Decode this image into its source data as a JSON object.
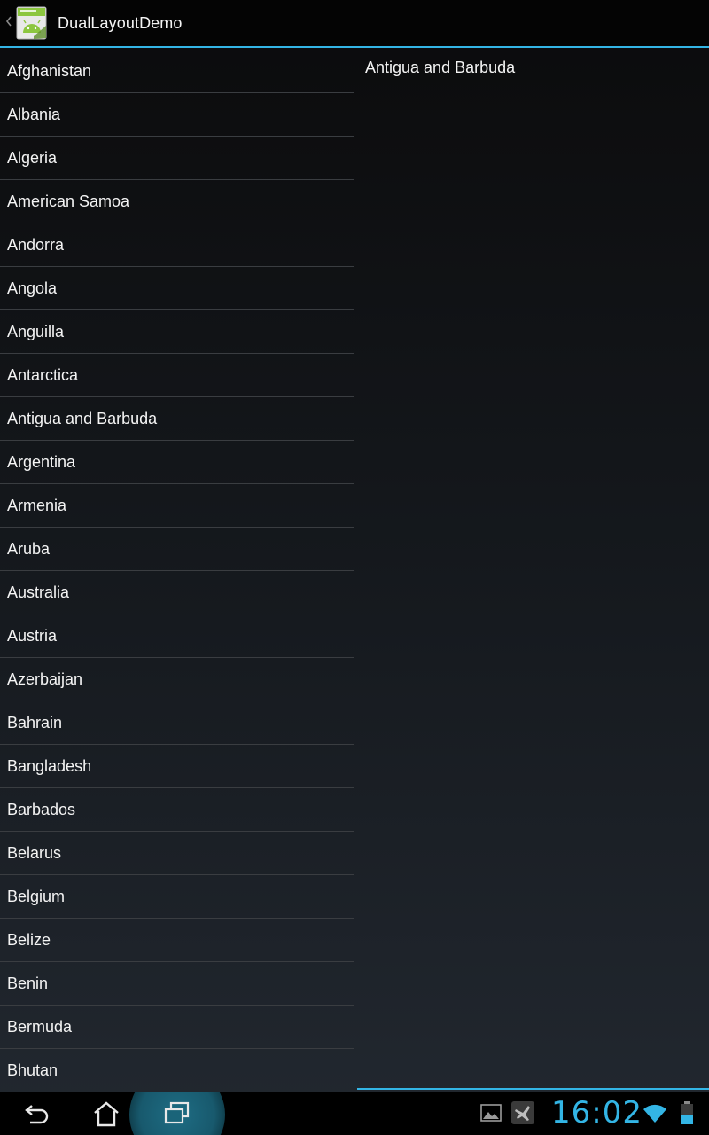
{
  "action_bar": {
    "title": "DualLayoutDemo",
    "app_icon": "android-app-icon",
    "up_icon": "up-caret-icon"
  },
  "country_list": {
    "items": [
      "Afghanistan",
      "Albania",
      "Algeria",
      "American Samoa",
      "Andorra",
      "Angola",
      "Anguilla",
      "Antarctica",
      "Antigua and Barbuda",
      "Argentina",
      "Armenia",
      "Aruba",
      "Australia",
      "Austria",
      "Azerbaijan",
      "Bahrain",
      "Bangladesh",
      "Barbados",
      "Belarus",
      "Belgium",
      "Belize",
      "Benin",
      "Bermuda",
      "Bhutan"
    ]
  },
  "detail": {
    "selected": "Antigua and Barbuda"
  },
  "system_bar": {
    "time": "16:02",
    "icons": [
      "back-icon",
      "home-icon",
      "recents-icon",
      "gallery-notification-icon",
      "airplane-mode-icon",
      "wifi-icon",
      "battery-icon"
    ]
  },
  "colors": {
    "accent": "#33b5e5",
    "divider": "#3a3d41",
    "text": "#f4f4f4"
  }
}
